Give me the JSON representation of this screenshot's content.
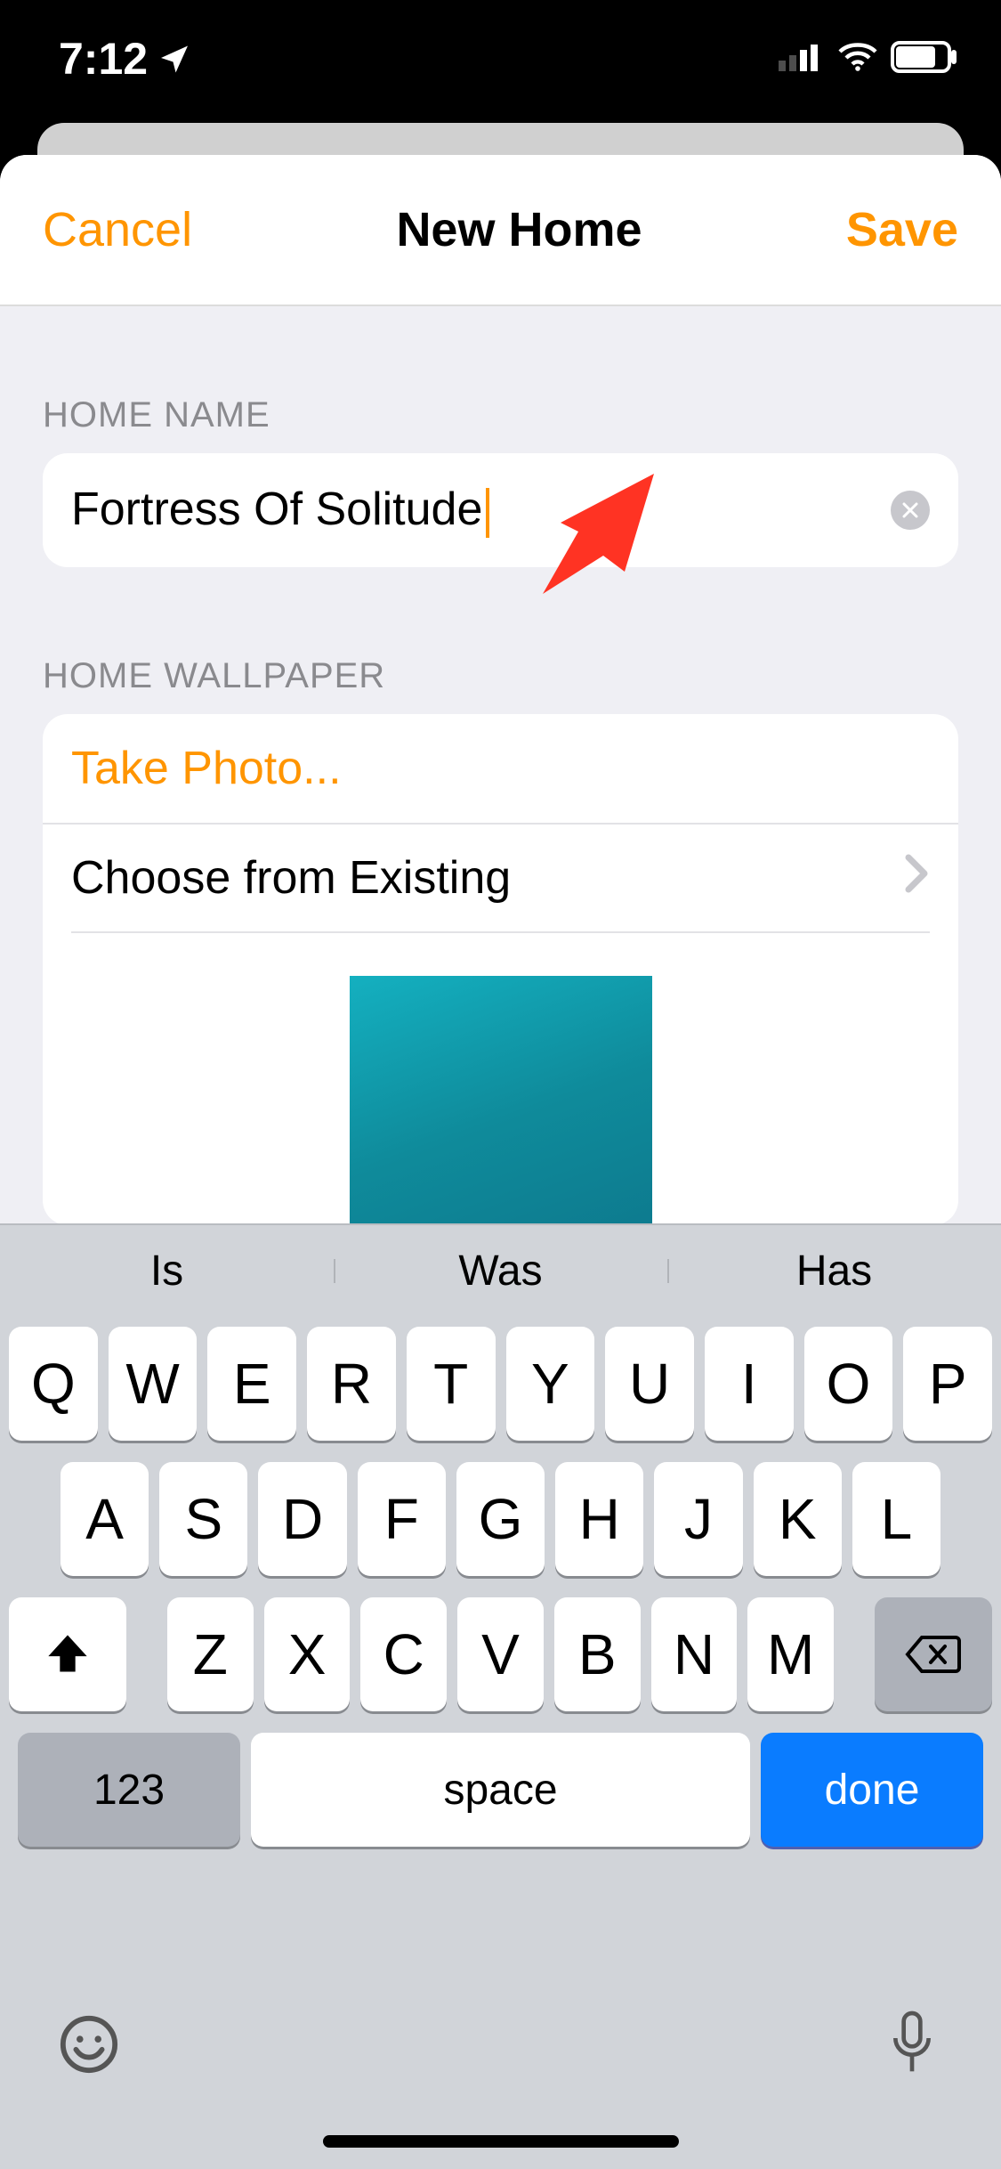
{
  "status": {
    "time": "7:12",
    "location_icon": "location-arrow"
  },
  "nav": {
    "cancel": "Cancel",
    "title": "New Home",
    "save": "Save"
  },
  "sections": {
    "home_name_header": "HOME NAME",
    "home_wallpaper_header": "HOME WALLPAPER"
  },
  "home_name": {
    "value": "Fortress Of Solitude"
  },
  "wallpaper_options": {
    "take_photo": "Take Photo...",
    "choose_existing": "Choose from Existing"
  },
  "keyboard": {
    "suggestions": [
      "Is",
      "Was",
      "Has"
    ],
    "row1": [
      "Q",
      "W",
      "E",
      "R",
      "T",
      "Y",
      "U",
      "I",
      "O",
      "P"
    ],
    "row2": [
      "A",
      "S",
      "D",
      "F",
      "G",
      "H",
      "J",
      "K",
      "L"
    ],
    "row3": [
      "Z",
      "X",
      "C",
      "V",
      "B",
      "N",
      "M"
    ],
    "numeric_label": "123",
    "space_label": "space",
    "done_label": "done"
  }
}
